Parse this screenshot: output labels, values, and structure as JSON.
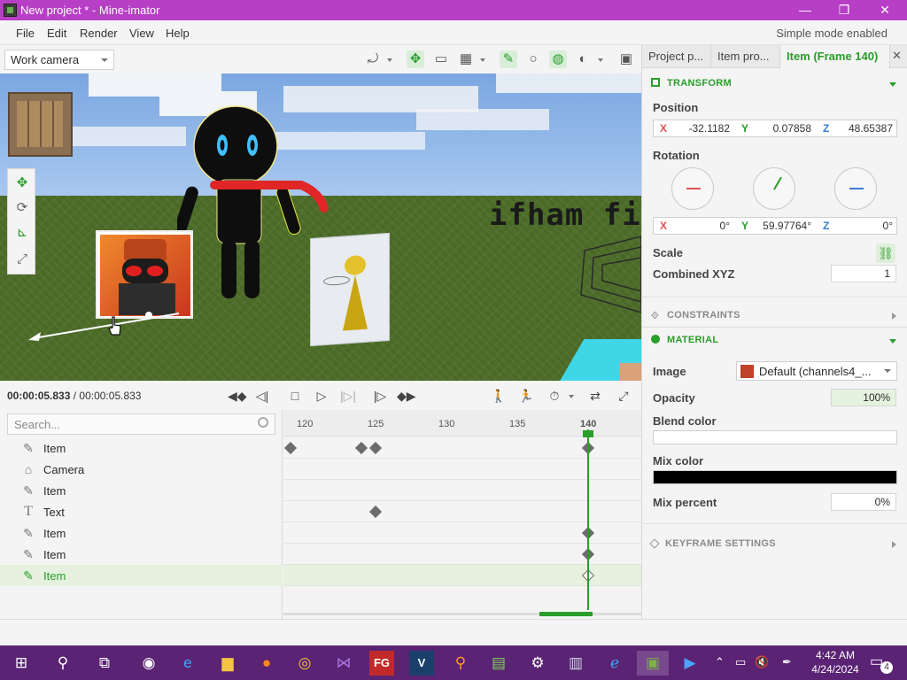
{
  "window": {
    "title": "New project * - Mine-imator",
    "minimize": "—",
    "maximize": "❐",
    "close": "✕"
  },
  "menubar": {
    "items": [
      "File",
      "Edit",
      "Render",
      "View",
      "Help"
    ],
    "simple_mode": "Simple mode enabled"
  },
  "viewport_toolbar": {
    "camera": "Work camera"
  },
  "viewport": {
    "sign_text": "ifham fi"
  },
  "timeline": {
    "time_current": "00:00:05.833",
    "time_total": "/ 00:00:05.833",
    "search_placeholder": "Search...",
    "ruler_labels": [
      "120",
      "125",
      "130",
      "135",
      "140"
    ],
    "tree": [
      {
        "label": "Item",
        "icon": "pencil-icon"
      },
      {
        "label": "Camera",
        "icon": "camera-icon"
      },
      {
        "label": "Item",
        "icon": "pencil-icon"
      },
      {
        "label": "Text",
        "icon": "text-icon"
      },
      {
        "label": "Item",
        "icon": "pencil-icon"
      },
      {
        "label": "Item",
        "icon": "pencil-icon"
      },
      {
        "label": "Item",
        "icon": "pencil-icon",
        "selected": true
      }
    ]
  },
  "panel": {
    "tabs": [
      "Project p...",
      "Item pro...",
      "Item (Frame 140)"
    ],
    "close_tab": "✕",
    "transform": {
      "header": "TRANSFORM",
      "position_label": "Position",
      "position": {
        "x_label": "X",
        "x": "-32.1182",
        "y_label": "Y",
        "y": "0.07858",
        "z_label": "Z",
        "z": "48.65387"
      },
      "rotation_label": "Rotation",
      "rotation": {
        "x_label": "X",
        "x": "0°",
        "y_label": "Y",
        "y": "59.97764°",
        "z_label": "Z",
        "z": "0°"
      },
      "scale_label": "Scale",
      "combined_label": "Combined XYZ",
      "combined_value": "1"
    },
    "constraints_header": "CONSTRAINTS",
    "material": {
      "header": "MATERIAL",
      "image_label": "Image",
      "image_value": "Default (channels4_...",
      "opacity_label": "Opacity",
      "opacity_value": "100%",
      "blend_label": "Blend color",
      "blend_color": "#ffffff",
      "mix_label": "Mix color",
      "mix_color": "#000000",
      "mix_percent_label": "Mix percent",
      "mix_percent_value": "0%"
    },
    "keyframe_header": "KEYFRAME SETTINGS"
  },
  "taskbar": {
    "time": "4:42 AM",
    "date": "4/24/2024",
    "notification_count": "4"
  },
  "colors": {
    "titlebar": "#b63fc5",
    "accent": "#2a9d2a",
    "taskbar": "#5b2374"
  }
}
